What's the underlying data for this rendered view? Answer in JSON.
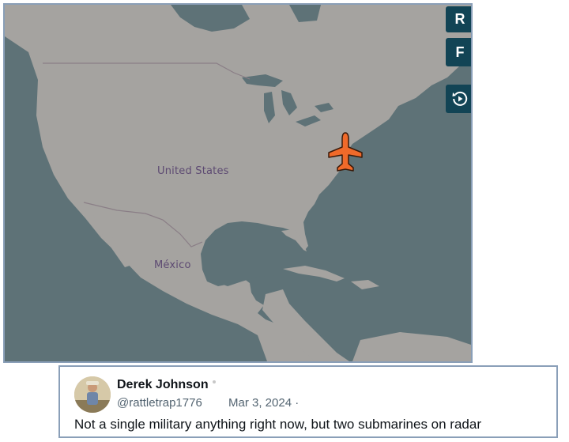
{
  "map": {
    "buttons": {
      "r_label": "R",
      "f_label": "F",
      "replay_icon": "replay-icon"
    },
    "labels": {
      "united_states": "United States",
      "mexico": "México"
    },
    "aircraft_icon": "airplane-icon",
    "colors": {
      "land": "#a5a3a0",
      "water": "#5e7277",
      "button_bg": "#124455",
      "aircraft": "#f06a2a"
    }
  },
  "tweet": {
    "author_name": "Derek Johnson",
    "handle": "@rattletrap1776",
    "date": "Mar 3, 2024 ·",
    "text": "Not a single military anything right now, but two submarines on radar"
  }
}
